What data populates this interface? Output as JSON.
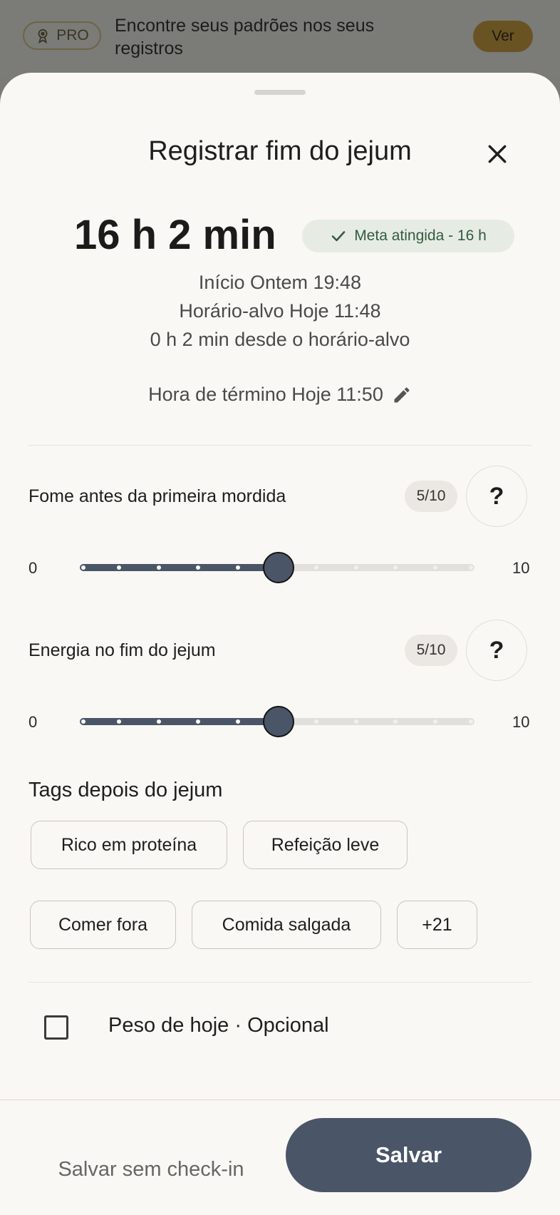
{
  "banner": {
    "badge_label": "PRO",
    "badge_icon": "award-icon",
    "text": "Encontre seus padrões nos seus registros",
    "button_label": "Ver"
  },
  "sheet": {
    "title": "Registrar fim do jejum",
    "close_icon": "close-icon"
  },
  "summary": {
    "duration": "16 h 2 min",
    "goal_badge": "Meta atingida - 16 h",
    "start": "Início Ontem 19:48",
    "target": "Horário-alvo Hoje 11:48",
    "since_target": "0 h 2 min desde o horário-alvo",
    "end_time": "Hora de término Hoje 11:50",
    "edit_icon": "pencil-icon"
  },
  "questions": [
    {
      "label": "Fome antes da primeira mordida",
      "score": "5/10",
      "help": "?",
      "min": "0",
      "max": "10",
      "value": 5,
      "range": [
        0,
        10
      ]
    },
    {
      "label": "Energia no fim do jejum",
      "score": "5/10",
      "help": "?",
      "min": "0",
      "max": "10",
      "value": 5,
      "range": [
        0,
        10
      ]
    }
  ],
  "tags": {
    "title": "Tags depois do jejum",
    "items": [
      "Rico em proteína",
      "Refeição leve",
      "Comer fora",
      "Comida salgada",
      "+21"
    ]
  },
  "weight": {
    "label": "Peso de hoje · Opcional",
    "checked": false
  },
  "footer": {
    "skip_label": "Salvar sem check-in",
    "save_label": "Salvar"
  },
  "colors": {
    "primary": "#4b5568",
    "sheet_bg": "#faf8f4",
    "goal_green": "#345a42",
    "banner_button": "#6a5323"
  }
}
